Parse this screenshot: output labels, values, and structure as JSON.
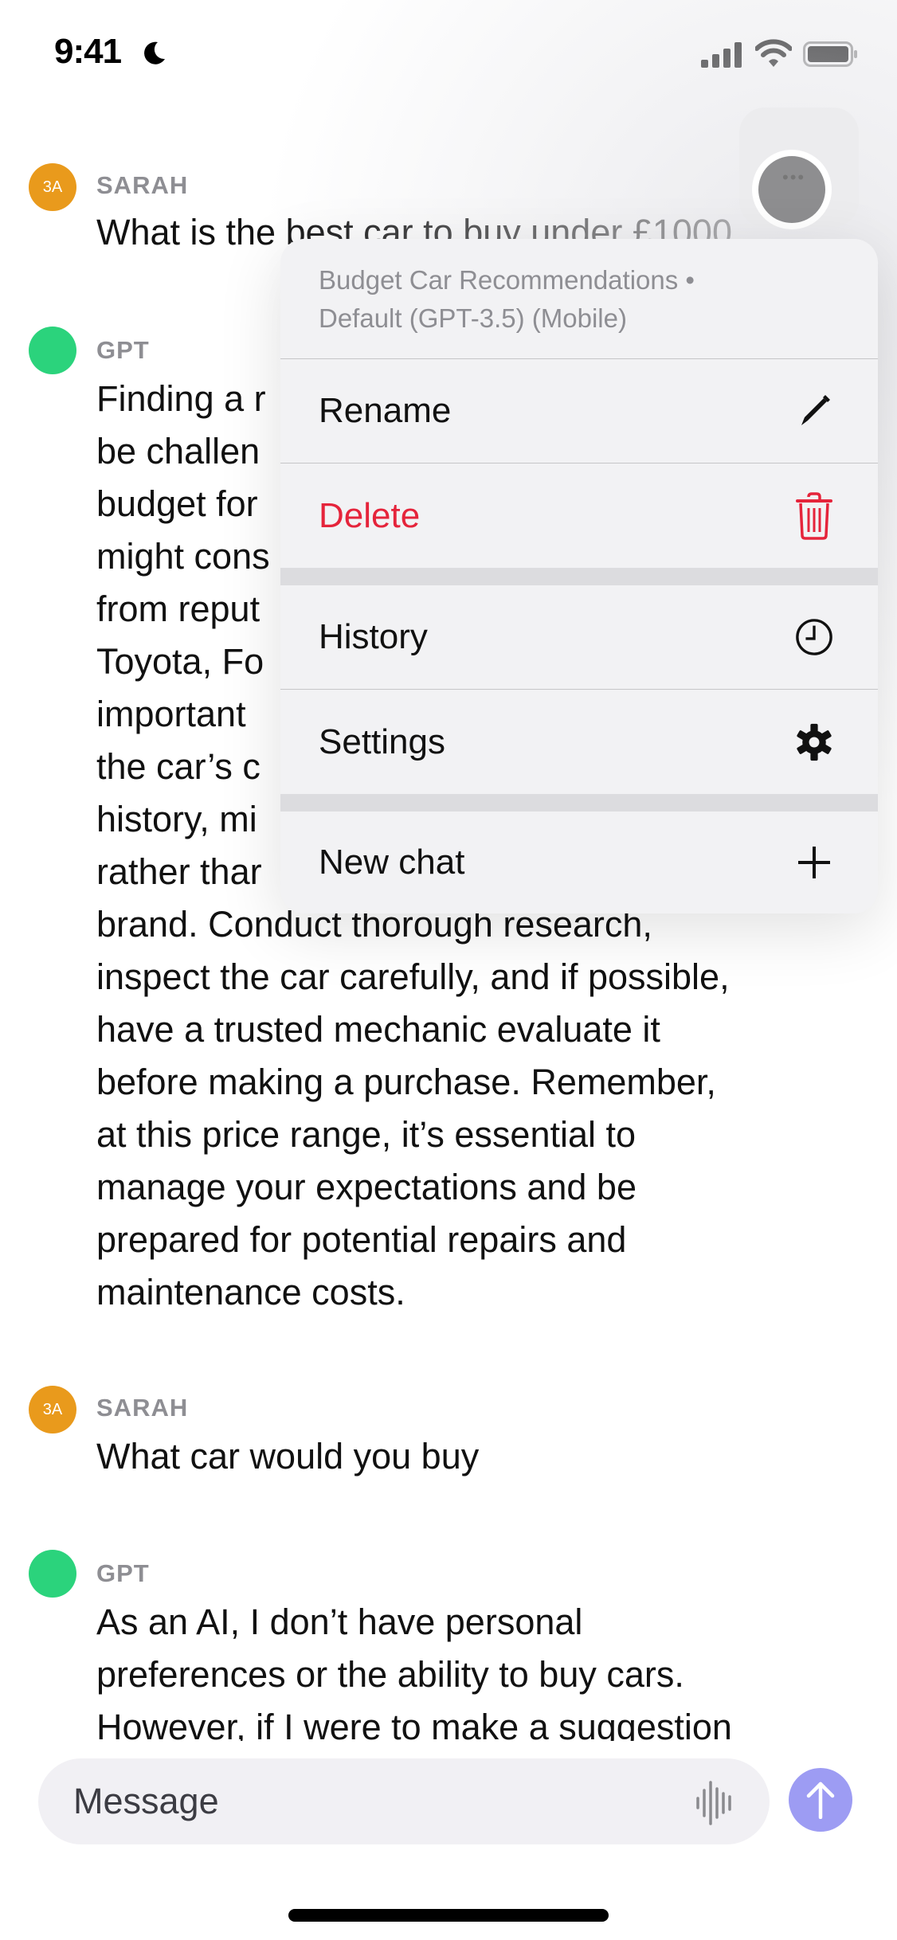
{
  "status_bar": {
    "time": "9:41",
    "focus_icon": "moon-icon",
    "icons": [
      "signal-icon",
      "wifi-icon",
      "battery-icon"
    ]
  },
  "messages": [
    {
      "role": "user",
      "avatar_text": "3A",
      "avatar_color": "#e99a1c",
      "sender": "SARAH",
      "text": "What is the best car to buy under £1000"
    },
    {
      "role": "assistant",
      "avatar_color": "#2bd37c",
      "sender": "GPT",
      "visible_lines": [
        "Finding a r",
        "be challen",
        "budget for",
        "might cons",
        "from reput",
        "Toyota, Fo",
        "important",
        "the car’s c",
        "history, mi",
        "rather thar",
        "brand. Conduct thorough research,",
        "inspect the car carefully, and if possible,",
        "have a trusted mechanic evaluate it",
        "before making a purchase. Remember,",
        "at this price range, it’s essential to",
        "manage your expectations and be",
        "prepared for potential repairs and",
        "maintenance costs."
      ]
    },
    {
      "role": "user",
      "avatar_text": "3A",
      "avatar_color": "#e99a1c",
      "sender": "SARAH",
      "text": "What car would you buy"
    },
    {
      "role": "assistant",
      "avatar_color": "#2bd37c",
      "sender": "GPT",
      "visible_lines": [
        "As an AI, I don’t have personal",
        "preferences or the ability to buy cars.",
        "However, if I were to make a suggestion"
      ]
    }
  ],
  "context_menu": {
    "header_line1": "Budget Car Recommendations •",
    "header_line2": "Default (GPT-3.5) (Mobile)",
    "groups": [
      [
        {
          "label": "Rename",
          "icon": "pencil-icon",
          "danger": false
        },
        {
          "label": "Delete",
          "icon": "trash-icon",
          "danger": true
        }
      ],
      [
        {
          "label": "History",
          "icon": "clock-icon",
          "danger": false
        },
        {
          "label": "Settings",
          "icon": "gear-icon",
          "danger": false
        }
      ],
      [
        {
          "label": "New chat",
          "icon": "plus-icon",
          "danger": false
        }
      ]
    ],
    "danger_color": "#e5243b"
  },
  "more_button": {
    "icon": "ellipsis-icon"
  },
  "composer": {
    "placeholder": "Message",
    "voice_icon": "waveform-icon",
    "send_icon": "arrow-up-icon",
    "send_color": "#9d9cf3"
  }
}
